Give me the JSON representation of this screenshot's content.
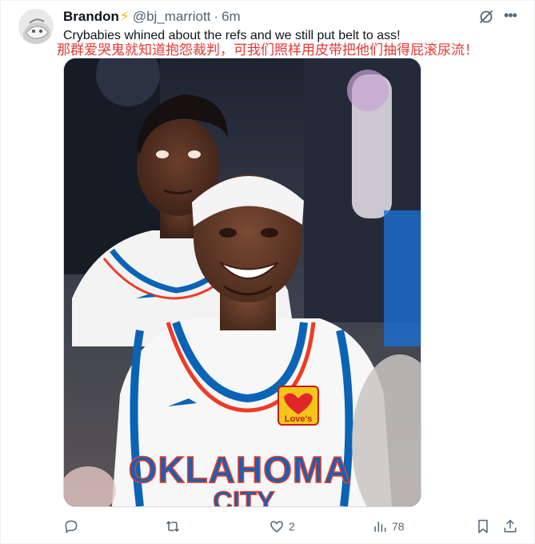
{
  "tweet": {
    "author_name": "Brandon",
    "author_badge": "⚡",
    "handle": "@bj_marriott",
    "separator": "·",
    "time": "6m",
    "text": "Crybabies whined about the refs and we still put belt to ass!",
    "translation": "那群爱哭鬼就知道抱怨裁判，可我们照样用皮带把他们抽得屁滚尿流！",
    "translation_color": "#e53935"
  },
  "media": {
    "jersey_text_front": "OKLAHOMA",
    "jersey_text_city": "CITY",
    "sponsor_patch": "Love's",
    "colors": {
      "jersey_blue": "#0b63b5",
      "jersey_orange": "#ef3b24",
      "jersey_white": "#f7f7f7"
    }
  },
  "actions": {
    "reply_count": "",
    "retweet_count": "",
    "like_count": "2",
    "views_count": "78"
  },
  "colors": {
    "text_primary": "#0f1419",
    "text_secondary": "#536471",
    "border": "#cfd9de"
  },
  "icons": [
    "grok-icon",
    "more-icon",
    "reply-icon",
    "retweet-icon",
    "like-icon",
    "views-icon",
    "bookmark-icon",
    "share-icon"
  ]
}
